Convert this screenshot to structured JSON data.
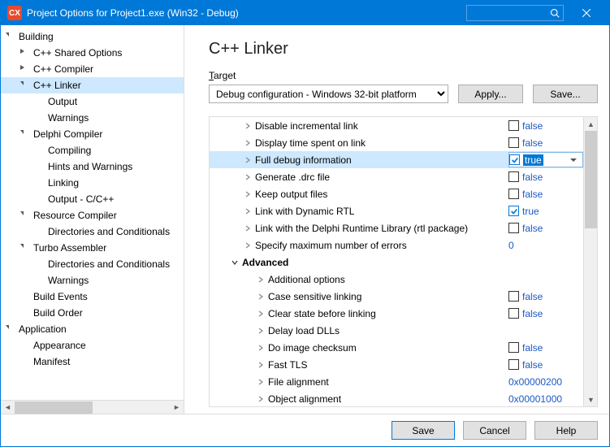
{
  "titlebar": {
    "logo": "CX",
    "title": "Project Options for Project1.exe  (Win32 - Debug)"
  },
  "sidebar": {
    "items": [
      {
        "label": "Building",
        "level": 0,
        "caret": "expanded",
        "header": true
      },
      {
        "label": "C++ Shared Options",
        "level": 1,
        "caret": "collapsed"
      },
      {
        "label": "C++ Compiler",
        "level": 1,
        "caret": "collapsed"
      },
      {
        "label": "C++ Linker",
        "level": 1,
        "caret": "expanded",
        "selected": true
      },
      {
        "label": "Output",
        "level": 2
      },
      {
        "label": "Warnings",
        "level": 2
      },
      {
        "label": "Delphi Compiler",
        "level": 1,
        "caret": "expanded"
      },
      {
        "label": "Compiling",
        "level": 2
      },
      {
        "label": "Hints and Warnings",
        "level": 2
      },
      {
        "label": "Linking",
        "level": 2
      },
      {
        "label": "Output - C/C++",
        "level": 2
      },
      {
        "label": "Resource Compiler",
        "level": 1,
        "caret": "expanded"
      },
      {
        "label": "Directories and Conditionals",
        "level": 2
      },
      {
        "label": "Turbo Assembler",
        "level": 1,
        "caret": "expanded"
      },
      {
        "label": "Directories and Conditionals",
        "level": 2
      },
      {
        "label": "Warnings",
        "level": 2
      },
      {
        "label": "Build Events",
        "level": 1
      },
      {
        "label": "Build Order",
        "level": 1
      },
      {
        "label": "Application",
        "level": 0,
        "caret": "expanded",
        "header": true
      },
      {
        "label": "Appearance",
        "level": 1
      },
      {
        "label": "Manifest",
        "level": 1
      }
    ]
  },
  "main": {
    "heading": "C++ Linker",
    "targetLabel": "arget",
    "targetSelected": "Debug configuration - Windows 32-bit platform",
    "apply": "Apply...",
    "save": "Save...",
    "options": [
      {
        "name": "Disable incremental link",
        "caret": "right",
        "level": 0,
        "checkbox": true,
        "checked": false,
        "value": "false"
      },
      {
        "name": "Display time spent on link",
        "caret": "right",
        "level": 0,
        "checkbox": true,
        "checked": false,
        "value": "false"
      },
      {
        "name": "Full debug information",
        "caret": "right",
        "level": 0,
        "checkbox": true,
        "checked": true,
        "value": "true",
        "selected": true
      },
      {
        "name": "Generate .drc file",
        "caret": "right",
        "level": 0,
        "checkbox": true,
        "checked": false,
        "value": "false"
      },
      {
        "name": "Keep output files",
        "caret": "right",
        "level": 0,
        "checkbox": true,
        "checked": false,
        "value": "false"
      },
      {
        "name": "Link with Dynamic RTL",
        "caret": "right",
        "level": 0,
        "checkbox": true,
        "checked": true,
        "value": "true"
      },
      {
        "name": "Link with the Delphi Runtime Library (rtl package)",
        "caret": "right",
        "level": 0,
        "checkbox": true,
        "checked": false,
        "value": "false"
      },
      {
        "name": "Specify maximum number of errors",
        "caret": "right",
        "level": 0,
        "value": "0"
      },
      {
        "name": "Advanced",
        "caret": "down",
        "level": -1,
        "group": true
      },
      {
        "name": "Additional options",
        "caret": "right",
        "level": 1
      },
      {
        "name": "Case sensitive linking",
        "caret": "right",
        "level": 1,
        "checkbox": true,
        "checked": false,
        "value": "false"
      },
      {
        "name": "Clear state before linking",
        "caret": "right",
        "level": 1,
        "checkbox": true,
        "checked": false,
        "value": "false"
      },
      {
        "name": "Delay load DLLs",
        "caret": "right",
        "level": 1
      },
      {
        "name": "Do image checksum",
        "caret": "right",
        "level": 1,
        "checkbox": true,
        "checked": false,
        "value": "false"
      },
      {
        "name": "Fast TLS",
        "caret": "right",
        "level": 1,
        "checkbox": true,
        "checked": false,
        "value": "false"
      },
      {
        "name": "File alignment",
        "caret": "right",
        "level": 1,
        "value": "0x00000200"
      },
      {
        "name": "Object alignment",
        "caret": "right",
        "level": 1,
        "value": "0x00001000"
      }
    ]
  },
  "footer": {
    "save": "Save",
    "cancel": "Cancel",
    "help": "Help"
  }
}
